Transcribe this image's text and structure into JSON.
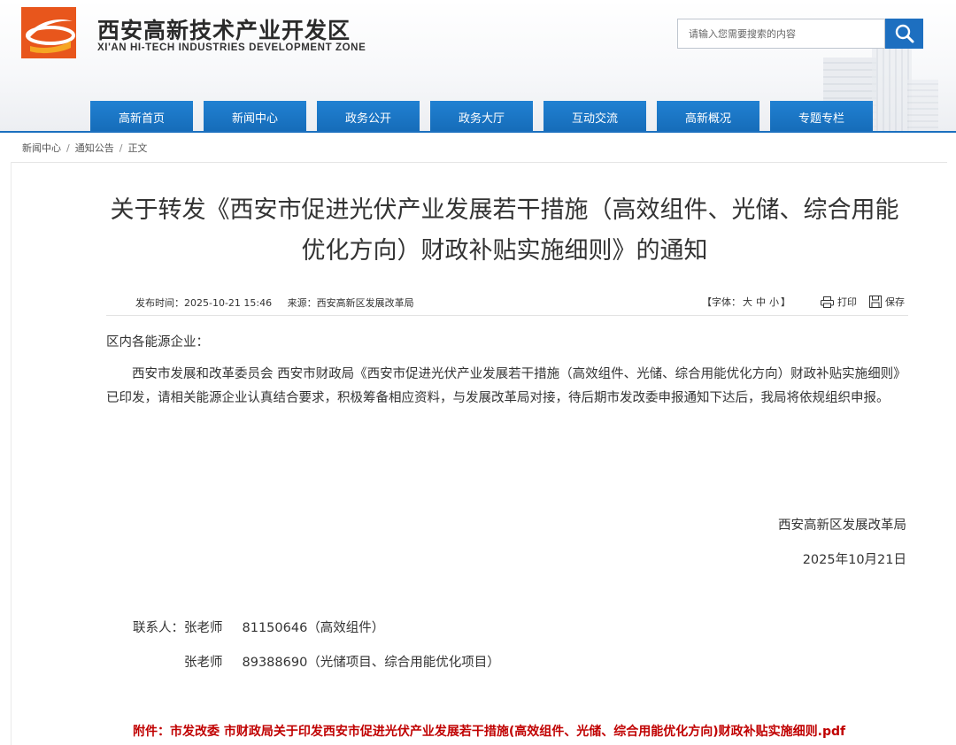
{
  "header": {
    "site_title_cn": "西安高新技术产业开发区",
    "site_title_en": "XI'AN HI-TECH INDUSTRIES DEVELOPMENT ZONE",
    "logo_icon": "xian-hitech-logo-icon",
    "brand_colors": {
      "orange": "#e8561c",
      "blue": "#1d6fc0"
    }
  },
  "search": {
    "placeholder": "请输入您需要搜索的内容",
    "icon": "search-icon"
  },
  "nav": {
    "items": [
      {
        "label": "高新首页"
      },
      {
        "label": "新闻中心"
      },
      {
        "label": "政务公开"
      },
      {
        "label": "政务大厅"
      },
      {
        "label": "互动交流"
      },
      {
        "label": "高新概况"
      },
      {
        "label": "专题专栏"
      }
    ]
  },
  "breadcrumb": {
    "items": [
      "新闻中心",
      "通知公告",
      "正文"
    ],
    "separator": "/"
  },
  "article": {
    "title_line1": "关于转发《西安市促进光伏产业发展若干措施（高效组件、光储、综合用能",
    "title_line2": "优化方向）财政补贴实施细则》的通知",
    "publish_time": "发布时间：2025-10-21 15:46",
    "source": "来源：西安高新区发展改革局",
    "font_label_prefix": "【字体：",
    "font_sizes": [
      "大",
      "中",
      "小"
    ],
    "font_label_suffix": "】",
    "print_label": "打印",
    "save_label": "保存",
    "greeting": "区内各能源企业：",
    "paragraph": "西安市发展和改革委员会 西安市财政局《西安市促进光伏产业发展若干措施（高效组件、光储、综合用能优化方向）财政补贴实施细则》已印发，请相关能源企业认真结合要求，积极筹备相应资料，与发展改革局对接，待后期市发改委申报通知下达后，我局将依规组织申报。",
    "signature_org": "西安高新区发展改革局",
    "signature_date": "2025年10月21日",
    "contacts": [
      {
        "name": "联系人：张老师",
        "phone": "81150646（高效组件）"
      },
      {
        "name": "张老师",
        "phone": "89388690（光储项目、综合用能优化项目）"
      }
    ],
    "attachment": "附件：市发改委 市财政局关于印发西安市促进光伏产业发展若干措施(高效组件、光储、综合用能优化方向)财政补贴实施细则.pdf",
    "attachment_color": "#c00000"
  }
}
